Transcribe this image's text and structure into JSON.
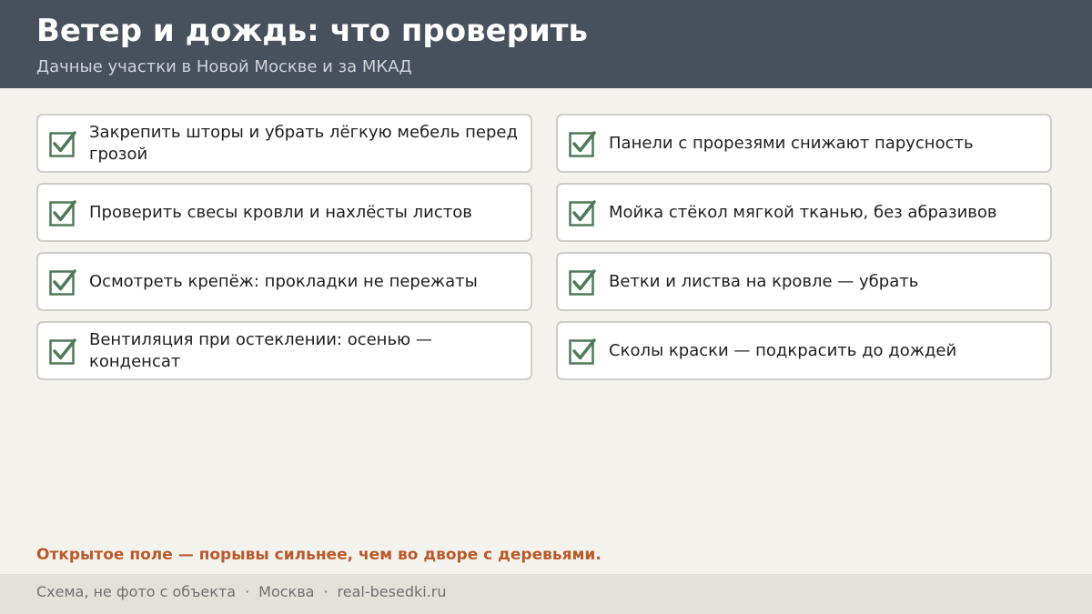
{
  "header": {
    "title": "Ветер и дождь: что проверить",
    "subtitle": "Дачные участки в Новой Москве и за МКАД"
  },
  "checklist": {
    "items": [
      {
        "text": "Закрепить шторы и убрать лёгкую мебель перед грозой",
        "checked": true
      },
      {
        "text": "Панели с прорезями снижают парусность",
        "checked": true
      },
      {
        "text": "Проверить свесы кровли и нахлёсты листов",
        "checked": true
      },
      {
        "text": "Мойка стёкол мягкой тканью, без абразивов",
        "checked": true
      },
      {
        "text": "Осмотреть крепёж: прокладки не пережаты",
        "checked": true
      },
      {
        "text": "Ветки и листва на кровле — убрать",
        "checked": true
      },
      {
        "text": "Вентиляция при остеклении: осенью — конденсат",
        "checked": true
      },
      {
        "text": "Сколы краски — подкрасить до дождей",
        "checked": true
      }
    ],
    "check_icon": "checkbox-checked-icon",
    "check_color": "#4f7a58"
  },
  "note": "Открытое поле — порывы сильнее, чем во дворе с деревьями.",
  "footer": {
    "caption": "Схема, не фото с объекта",
    "separator": "·",
    "city": "Москва",
    "site": "real-besedki.ru"
  },
  "colors": {
    "header_bg": "#47505d",
    "page_bg": "#f4f2ed",
    "accent": "#b95a2a",
    "footer_bg": "#e4e1da"
  }
}
